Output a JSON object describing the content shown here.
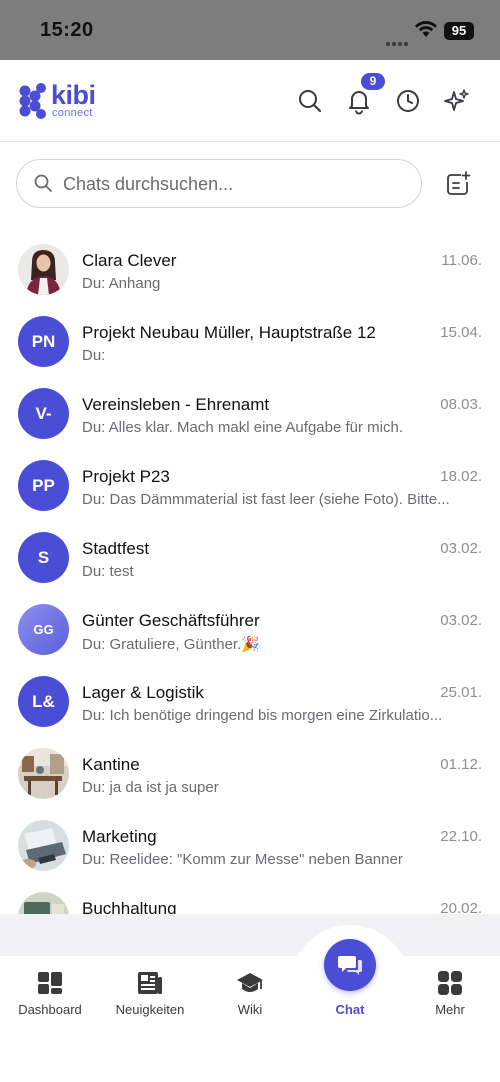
{
  "status_bar": {
    "time": "15:20",
    "battery": "95"
  },
  "header": {
    "logo_word": "kibi",
    "logo_sub": "connect",
    "notification_count": "9",
    "accent_color": "#4a4dd6"
  },
  "search": {
    "placeholder": "Chats durchsuchen...",
    "value": ""
  },
  "chats": [
    {
      "name": "Clara Clever",
      "date": "11.06.",
      "preview": "Du: Anhang",
      "avatar": "photo-woman"
    },
    {
      "name": "Projekt Neubau Müller, Hauptstraße 12",
      "date": "15.04.",
      "preview": "Du:",
      "avatar": "PN"
    },
    {
      "name": "Vereinsleben - Ehrenamt",
      "date": "08.03.",
      "preview": "Du: Alles klar. Mach makl eine Aufgabe für mich.",
      "avatar": "V-"
    },
    {
      "name": "Projekt P23",
      "date": "18.02.",
      "preview": "Du: Das Dämmmaterial ist fast leer (siehe Foto). Bitte...",
      "avatar": "PP"
    },
    {
      "name": "Stadtfest",
      "date": "03.02.",
      "preview": "Du: test",
      "avatar": "S"
    },
    {
      "name": "Günter Geschäftsführer",
      "date": "03.02.",
      "preview": "Du: Gratuliere, Günther.🎉",
      "avatar": "GG"
    },
    {
      "name": "Lager & Logistik",
      "date": "25.01.",
      "preview": "Du: Ich benötige dringend bis morgen eine Zirkulatio...",
      "avatar": "L&"
    },
    {
      "name": "Kantine",
      "date": "01.12.",
      "preview": "Du: ja da ist ja super",
      "avatar": "photo-cafe"
    },
    {
      "name": "Marketing",
      "date": "22.10.",
      "preview": "Du: Reelidee: \"Komm zur Messe\" neben Banner",
      "avatar": "photo-laptop"
    },
    {
      "name": "Buchhaltung",
      "date": "20.02.",
      "preview": "",
      "avatar": "photo-desk"
    }
  ],
  "nav": {
    "dashboard": "Dashboard",
    "news": "Neuigkeiten",
    "wiki": "Wiki",
    "chat": "Chat",
    "more": "Mehr"
  }
}
